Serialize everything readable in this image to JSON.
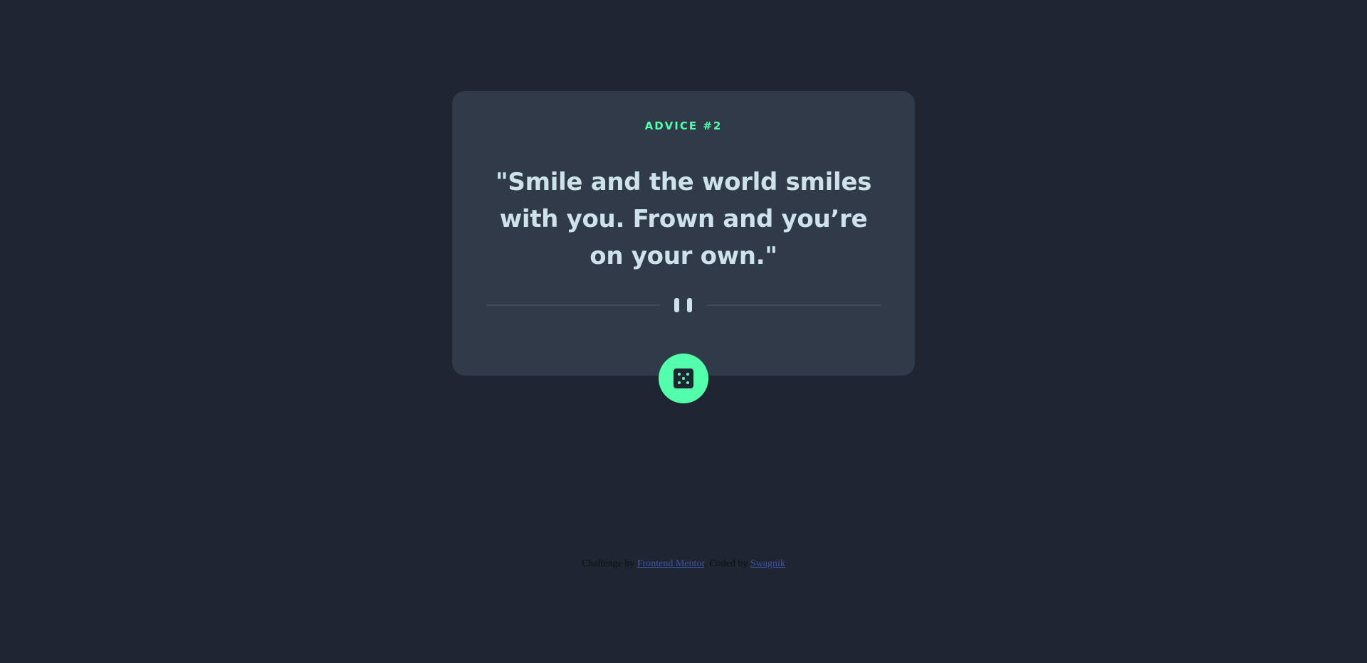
{
  "card": {
    "advice_label": "ADVICE #2",
    "quote": "\"Smile and the world smiles with you. Frown and you’re on your own.\""
  },
  "icons": {
    "divider": "pause-quote-icon",
    "dice": "dice-icon"
  },
  "footer": {
    "prefix": "Challenge by",
    "challenge_link": "Frontend Mentor",
    "middle": ". Coded by",
    "author_link": "Swagnik"
  },
  "colors": {
    "background": "#1f2632",
    "card": "#313a48",
    "accent": "#53ffaa",
    "quote_text": "#cee3e9",
    "divider": "#4f5d74",
    "link": "#3e52a3"
  }
}
